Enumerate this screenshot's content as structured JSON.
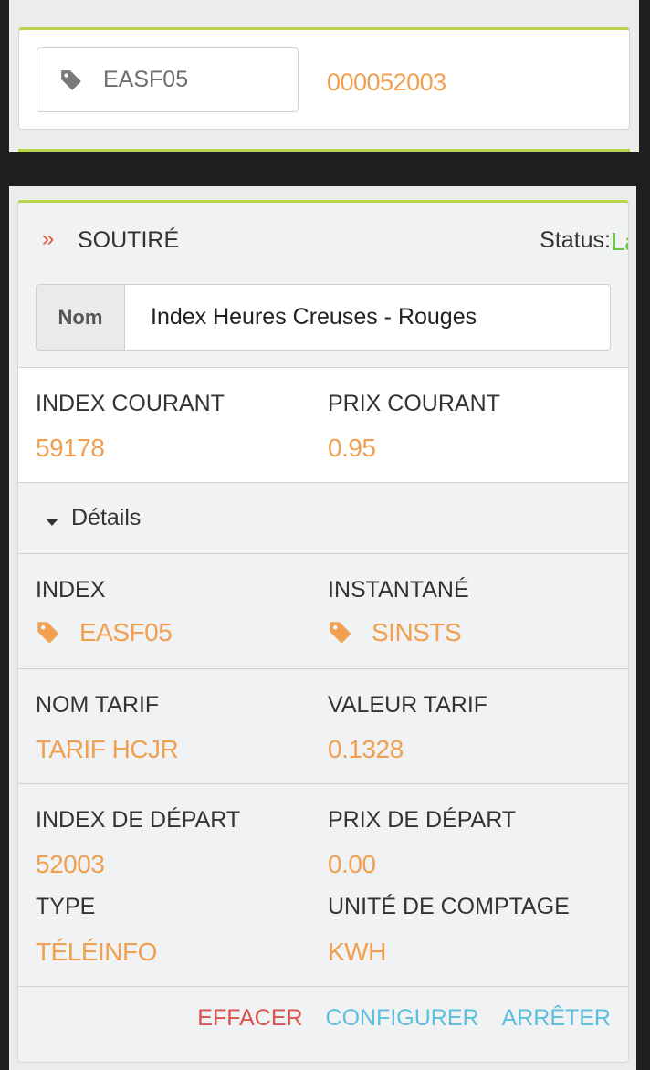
{
  "top_card": {
    "tag_value": "EASF05",
    "number": "000052003"
  },
  "main_card": {
    "title": "SOUTIRÉ",
    "status_label": "Status:",
    "status_value": "Lancé",
    "nom_label": "Nom",
    "nom_value": "Index Heures Creuses - Rouges",
    "index_courant_label": "INDEX COURANT",
    "index_courant_value": "59178",
    "prix_courant_label": "PRIX COURANT",
    "prix_courant_value": "0.95",
    "details_label": "Détails",
    "index_label": "INDEX",
    "index_value": "EASF05",
    "instantane_label": "INSTANTANÉ",
    "instantane_value": "SINSTS",
    "nom_tarif_label": "NOM TARIF",
    "nom_tarif_value": "TARIF HCJR",
    "valeur_tarif_label": "VALEUR TARIF",
    "valeur_tarif_value": "0.1328",
    "index_depart_label": "INDEX DE DÉPART",
    "index_depart_value": "52003",
    "prix_depart_label": "PRIX DE DÉPART",
    "prix_depart_value": "0.00",
    "type_label": "TYPE",
    "type_value": "TÉLÉINFO",
    "unite_label": "UNITÉ DE COMPTAGE",
    "unite_value": "KWH",
    "actions": {
      "effacer": "EFFACER",
      "configurer": "CONFIGURER",
      "arreter": "ARRÊTER"
    }
  },
  "colors": {
    "accent_orange": "#f0a050",
    "status_green": "#6cc644",
    "danger_red": "#d9534f",
    "info_blue": "#5bc0de",
    "card_border_green": "#b6d54a"
  },
  "icons": [
    "tag-icon",
    "double-chevron-right-icon",
    "caret-down-icon"
  ]
}
